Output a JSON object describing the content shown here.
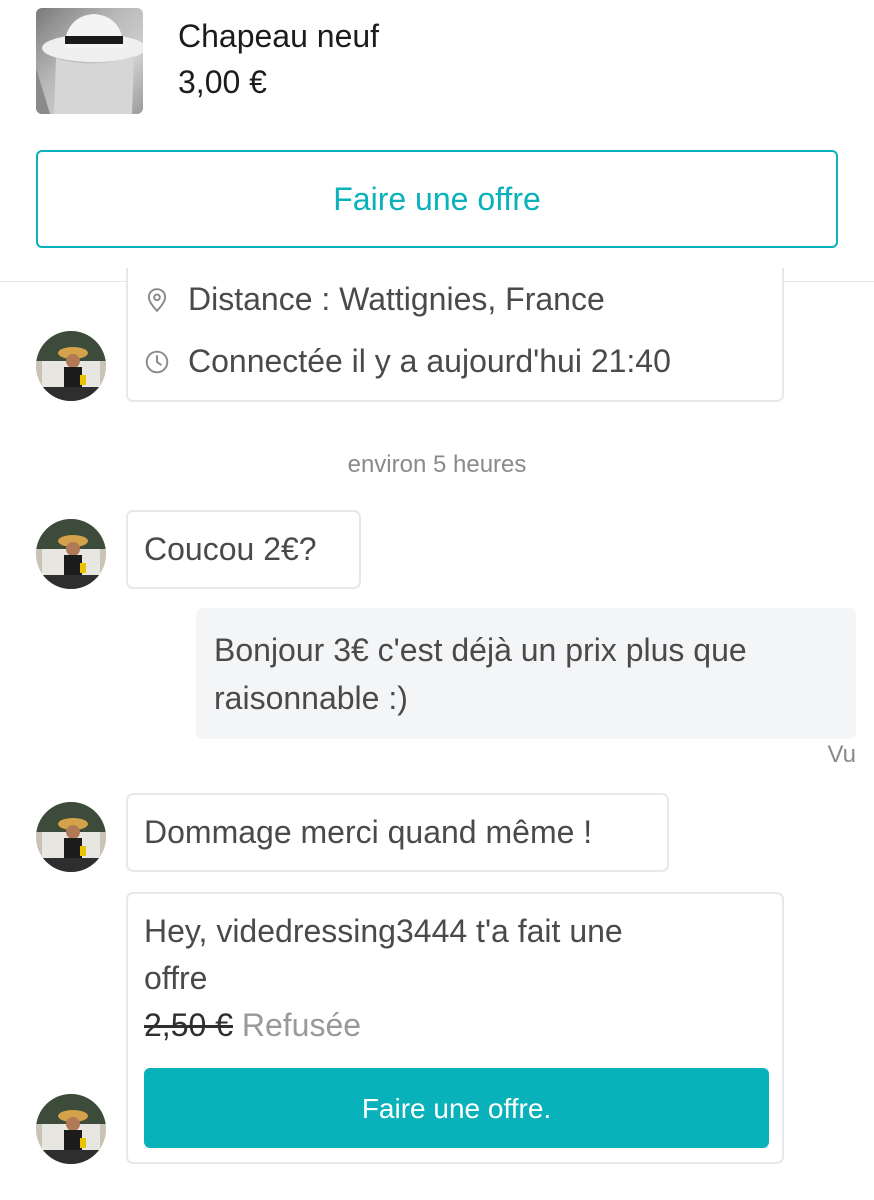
{
  "item": {
    "title": "Chapeau neuf",
    "price": "3,00 €",
    "thumbnail_icon": "hat-photo"
  },
  "actions": {
    "make_offer_label": "Faire une offre"
  },
  "profile_info": {
    "distance": "Distance : Wattignies, France",
    "last_seen": "Connectée il y a aujourd'hui 21:40"
  },
  "time_separator": "environ 5 heures",
  "messages": [
    {
      "from": "other",
      "text": "Coucou 2€?"
    },
    {
      "from": "me",
      "text_line1": "Bonjour 3€ c'est déjà un prix plus que",
      "text_line2": "raisonnable :)",
      "status": "Vu"
    },
    {
      "from": "other",
      "text": "Dommage merci quand même !"
    }
  ],
  "offer_message": {
    "line1": "Hey, videdressing3444 t'a fait une",
    "line2": "offre",
    "old_price": "2,50 €",
    "status": "Refusée",
    "button_label": "Faire une offre."
  },
  "colors": {
    "accent": "#09b1ba",
    "text": "#4a4a4a",
    "muted": "#8a8a8a",
    "border": "#e8e8e8",
    "my_bubble": "#f4f5f6"
  }
}
